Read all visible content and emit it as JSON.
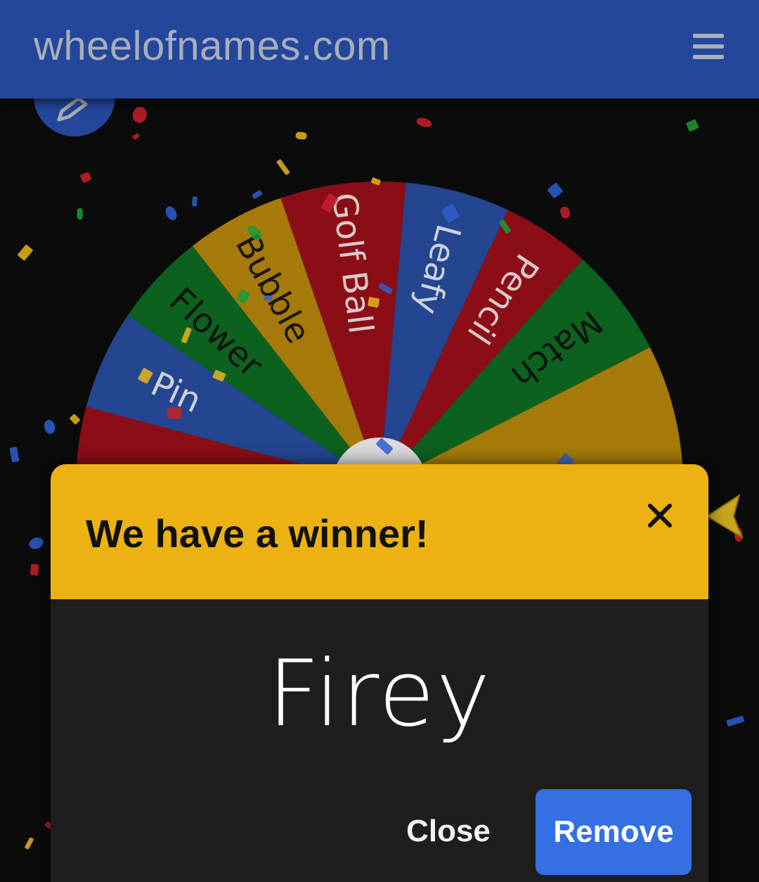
{
  "header": {
    "site_title": "wheelofnames.com",
    "menu_icon": "hamburger-menu-icon",
    "background_color": "#24479b"
  },
  "edit_button": {
    "icon": "pencil-icon"
  },
  "wheel": {
    "entries": [
      {
        "label": "Pin",
        "color": "#2c56b5"
      },
      {
        "label": "Flower",
        "color": "#0d7a24"
      },
      {
        "label": "Bubble",
        "color": "#d19a0a"
      },
      {
        "label": "Golf Ball",
        "color": "#b00f1b"
      },
      {
        "label": "Leafy",
        "color": "#2c56b5"
      },
      {
        "label": "Pencil",
        "color": "#b00f1b"
      },
      {
        "label": "Match",
        "color": "#0d7a24"
      }
    ],
    "colors": {
      "blue": "#2c56b5",
      "green": "#0d7a24",
      "yellow": "#d19a0a",
      "red": "#b00f1b"
    },
    "pointer_icon": "wheel-pointer-arrow-icon"
  },
  "dialog": {
    "title": "We have a winner!",
    "winner": "Firey",
    "close_icon": "close-icon",
    "close_label": "Close",
    "remove_label": "Remove",
    "header_color": "#ecb212",
    "remove_color": "#3470e4"
  }
}
